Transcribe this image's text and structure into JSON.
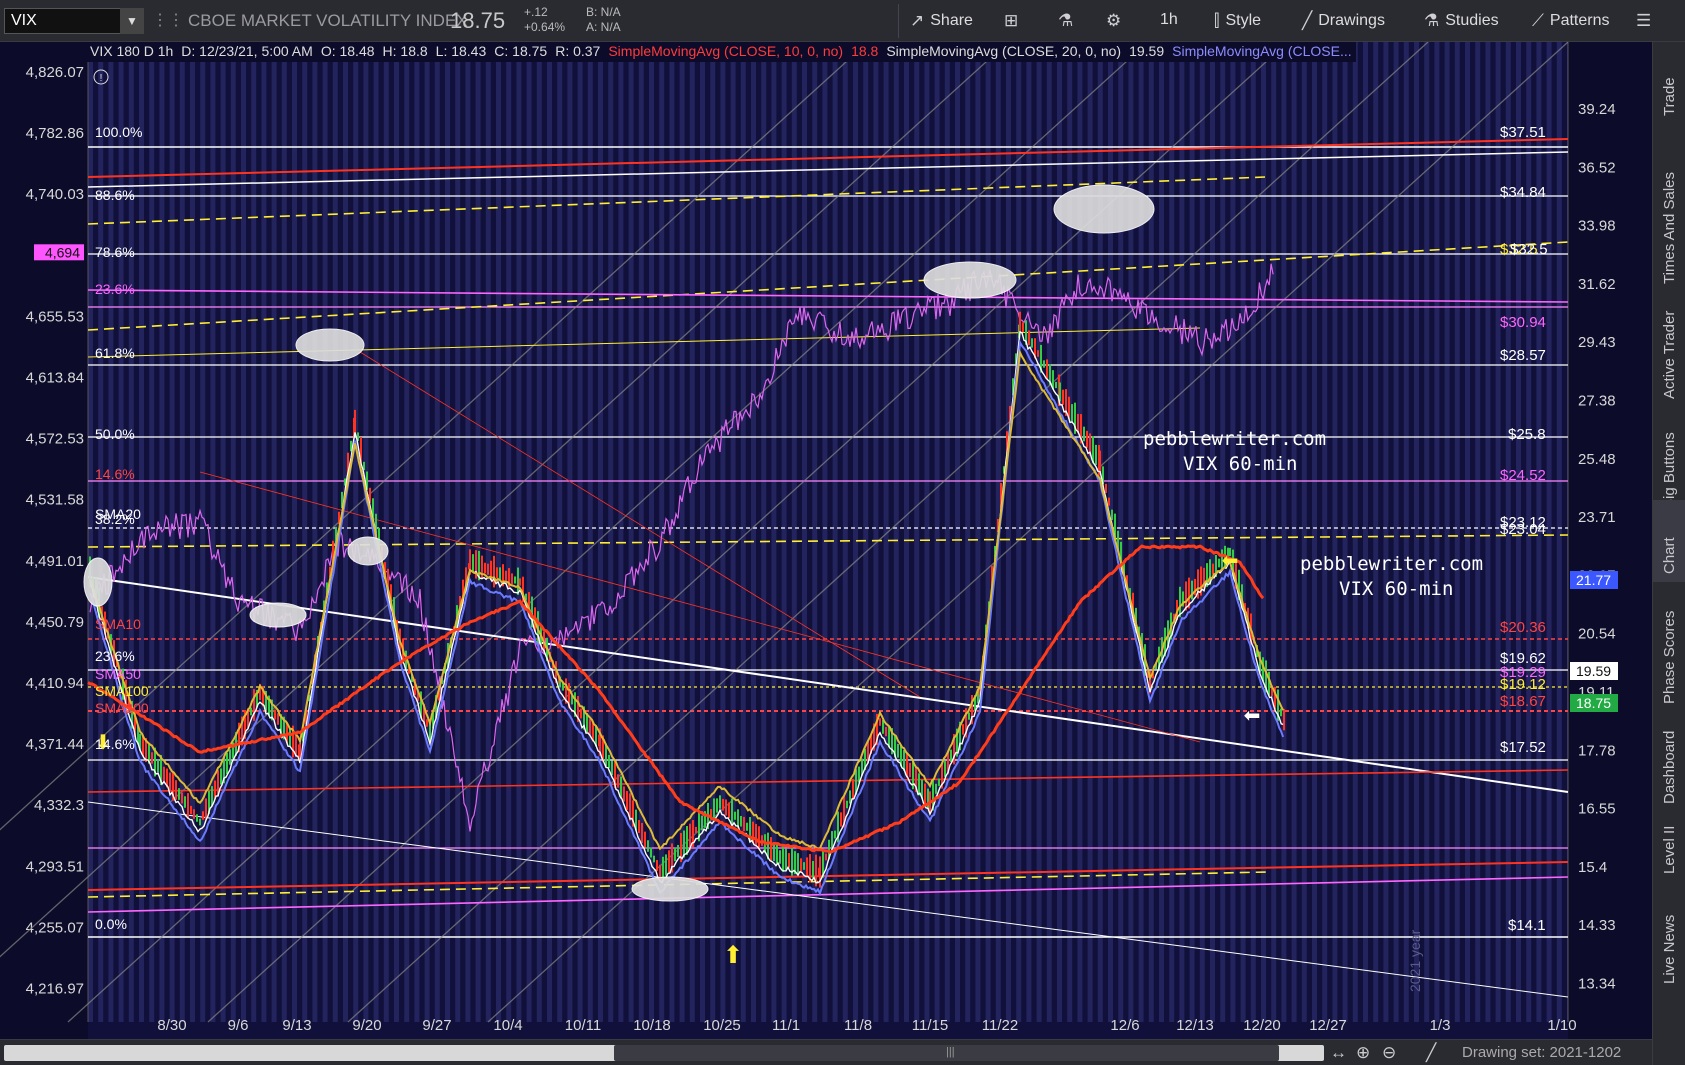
{
  "toolbar": {
    "symbol": "VIX",
    "description": "CBOE MARKET VOLATILITY INDEX",
    "last": "18.75",
    "change": "+.12",
    "change_pct": "+0.64%",
    "bid": "B: N/A",
    "ask": "A: N/A",
    "share": "Share",
    "timeframe": "1h",
    "style": "Style",
    "drawings": "Drawings",
    "studies": "Studies",
    "patterns": "Patterns"
  },
  "chart_header": {
    "symbol_period": "VIX 180 D 1h",
    "date": "D: 12/23/21, 5:00 AM",
    "open": "O: 18.48",
    "high": "H: 18.8",
    "low": "L: 18.43",
    "close": "C: 18.75",
    "range": "R: 0.37",
    "sma10_label": "SimpleMovingAvg (CLOSE, 10, 0, no)",
    "sma10_value": "18.8",
    "sma20_label": "SimpleMovingAvg (CLOSE, 20, 0, no)",
    "sma20_value": "19.59",
    "sma_more_label": "SimpleMovingAvg (CLOSE..."
  },
  "left_axis": [
    "4,826.07",
    "4,782.86",
    "4,740.03",
    "4,694",
    "4,655.53",
    "4,613.84",
    "4,572.53",
    "4,531.58",
    "4,491.01",
    "4,450.79",
    "4,410.94",
    "4,371.44",
    "4,332.3",
    "4,293.51",
    "4,255.07",
    "4,216.97"
  ],
  "left_axis_highlight": "4,694",
  "right_axis": [
    "39.24",
    "36.52",
    "33.98",
    "31.62",
    "29.43",
    "27.38",
    "25.48",
    "23.71",
    "22.07",
    "20.54",
    "19.11",
    "17.78",
    "16.55",
    "15.4",
    "14.33",
    "13.34"
  ],
  "right_badges": {
    "white": "19.59",
    "green": "18.75",
    "blue": "21.77"
  },
  "x_axis": [
    "8/30",
    "9/6",
    "9/13",
    "9/20",
    "9/27",
    "10/4",
    "10/11",
    "10/18",
    "10/25",
    "11/1",
    "11/8",
    "11/15",
    "11/22",
    "12/6",
    "12/13",
    "12/20",
    "12/27",
    "1/3",
    "1/10"
  ],
  "fib_labels_left": [
    {
      "text": "100.0%",
      "color": "#ffffff"
    },
    {
      "text": "88.6%",
      "color": "#ffffff"
    },
    {
      "text": "78.6%",
      "color": "#ffffff"
    },
    {
      "text": "23.6%",
      "color": "#ff66ff"
    },
    {
      "text": "61.8%",
      "color": "#ffffff"
    },
    {
      "text": "50.0%",
      "color": "#ffffff"
    },
    {
      "text": "14.6%",
      "color": "#ff4444"
    },
    {
      "text": "38.2%",
      "color": "#ffffff"
    },
    {
      "text": "SMA20",
      "color": "#ffffff"
    },
    {
      "text": "SMA10",
      "color": "#ff4444"
    },
    {
      "text": "23.6%",
      "color": "#ffffff"
    },
    {
      "text": "SMA50",
      "color": "#ff66ff"
    },
    {
      "text": "SMA100",
      "color": "#ffee33"
    },
    {
      "text": "SMA200",
      "color": "#ff4444"
    },
    {
      "text": "14.6%",
      "color": "#ffffff"
    },
    {
      "text": "0.0%",
      "color": "#ffffff"
    }
  ],
  "price_labels_right": [
    {
      "text": "$37.51",
      "color": "#ffffff"
    },
    {
      "text": "$34.84",
      "color": "#ffffff"
    },
    {
      "text": "$32.5",
      "color": "#ffee33"
    },
    {
      "text": "$32.5",
      "color": "#ffffff"
    },
    {
      "text": "$30.94",
      "color": "#ff66ff"
    },
    {
      "text": "$28.57",
      "color": "#ffffff"
    },
    {
      "text": "$25.8",
      "color": "#ffffff"
    },
    {
      "text": "$24.52",
      "color": "#ff66ff"
    },
    {
      "text": "$23.12",
      "color": "#ffffff"
    },
    {
      "text": "$23.04",
      "color": "#ffffff"
    },
    {
      "text": "$20.36",
      "color": "#ff4444"
    },
    {
      "text": "$19.62",
      "color": "#ffffff"
    },
    {
      "text": "$19.29",
      "color": "#ff66ff"
    },
    {
      "text": "$19.12",
      "color": "#ffee33"
    },
    {
      "text": "$18.67",
      "color": "#ff4444"
    },
    {
      "text": "$17.52",
      "color": "#ffffff"
    },
    {
      "text": "$14.1",
      "color": "#ffffff"
    }
  ],
  "watermarks": [
    {
      "line1": "pebblewriter.com",
      "line2": "VIX 60-min"
    },
    {
      "line1": "pebblewriter.com",
      "line2": "VIX 60-min"
    }
  ],
  "year_label": "2021 year",
  "right_tabs": [
    "Trade",
    "Times And Sales",
    "Active Trader",
    "Big Buttons",
    "Chart",
    "Phase Scores",
    "Dashboard",
    "Level II",
    "Live News"
  ],
  "active_tab": "Chart",
  "bottom": {
    "drawing_set": "Drawing set: 2021-1202"
  },
  "colors": {
    "bg": "#10103a",
    "stripe": "#23235e",
    "accent_green": "#22aa44",
    "accent_blue": "#3b57ff"
  }
}
